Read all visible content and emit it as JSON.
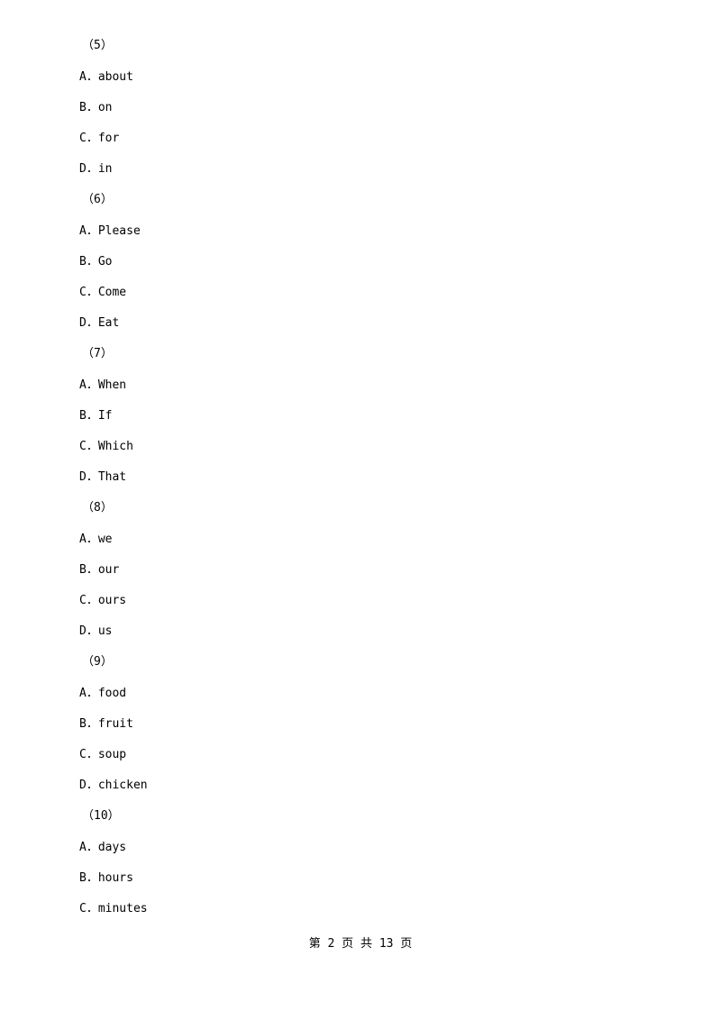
{
  "document": {
    "blocks": [
      {
        "number": "（5）",
        "options": [
          "A．about",
          "B．on",
          "C．for",
          "D．in"
        ]
      },
      {
        "number": "（6）",
        "options": [
          "A．Please",
          "B．Go",
          "C．Come",
          "D．Eat"
        ]
      },
      {
        "number": "（7）",
        "options": [
          "A．When",
          "B．If",
          "C．Which",
          "D．That"
        ]
      },
      {
        "number": "（8）",
        "options": [
          "A．we",
          "B．our",
          "C．ours",
          "D．us"
        ]
      },
      {
        "number": "（9）",
        "options": [
          "A．food",
          "B．fruit",
          "C．soup",
          "D．chicken"
        ]
      },
      {
        "number": "（10）",
        "options": [
          "A．days",
          "B．hours",
          "C．minutes"
        ]
      }
    ],
    "footer": "第 2 页 共 13 页"
  }
}
